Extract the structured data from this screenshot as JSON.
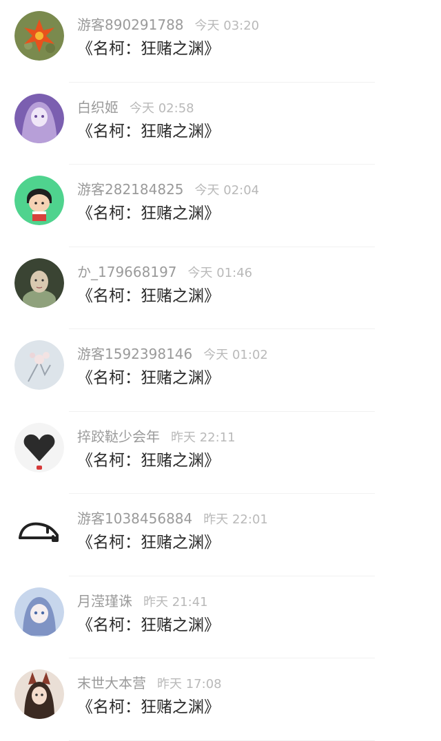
{
  "comments": [
    {
      "user": "游客890291788",
      "time": "今天 03:20",
      "text": "《名柯：狂赌之渊》",
      "avatar": "orange-leaf-avatar",
      "colors": [
        "#7a8a4e",
        "#e8521c",
        "#f7b733"
      ]
    },
    {
      "user": "白织姬",
      "time": "今天 02:58",
      "text": "《名柯：狂赌之渊》",
      "avatar": "purple-anime-girl-avatar",
      "colors": [
        "#b79fd8",
        "#efe6f7",
        "#7b5fb0"
      ]
    },
    {
      "user": "游客282184825",
      "time": "今天 02:04",
      "text": "《名柯：狂赌之渊》",
      "avatar": "chibi-maruko-avatar",
      "colors": [
        "#4fd38e",
        "#1f1f1f",
        "#f6d2b4"
      ]
    },
    {
      "user": "か_179668197",
      "time": "今天 01:46",
      "text": "《名柯：狂赌之渊》",
      "avatar": "portrait-girl-avatar",
      "colors": [
        "#3a4433",
        "#d9c9b0",
        "#8fa17c"
      ]
    },
    {
      "user": "游客1592398146",
      "time": "今天 01:02",
      "text": "《名柯：狂赌之渊》",
      "avatar": "cherry-blossom-avatar",
      "colors": [
        "#dde4ea",
        "#f3e3e3",
        "#9aa3ad"
      ]
    },
    {
      "user": "捽跤鞑少会年",
      "time": "昨天 22:11",
      "text": "《名柯：狂赌之渊》",
      "avatar": "black-heart-avatar",
      "colors": [
        "#f4f4f4",
        "#2b2b2b",
        "#d63a3a"
      ]
    },
    {
      "user": "游客1038456884",
      "time": "昨天 22:01",
      "text": "《名柯：狂赌之渊》",
      "avatar": "elephant-logo-avatar",
      "colors": [
        "#ffffff",
        "#222222",
        "#222222"
      ]
    },
    {
      "user": "月滢瑾诛",
      "time": "昨天 21:41",
      "text": "《名柯：狂赌之渊》",
      "avatar": "blue-anime-girl-avatar",
      "colors": [
        "#c7d6ec",
        "#f5eef0",
        "#7f93c4"
      ]
    },
    {
      "user": "末世大本营",
      "time": "昨天 17:08",
      "text": "《名柯：狂赌之渊》",
      "avatar": "fox-ear-girl-avatar",
      "colors": [
        "#eadfd6",
        "#8a3b2c",
        "#3b2a22"
      ]
    }
  ]
}
